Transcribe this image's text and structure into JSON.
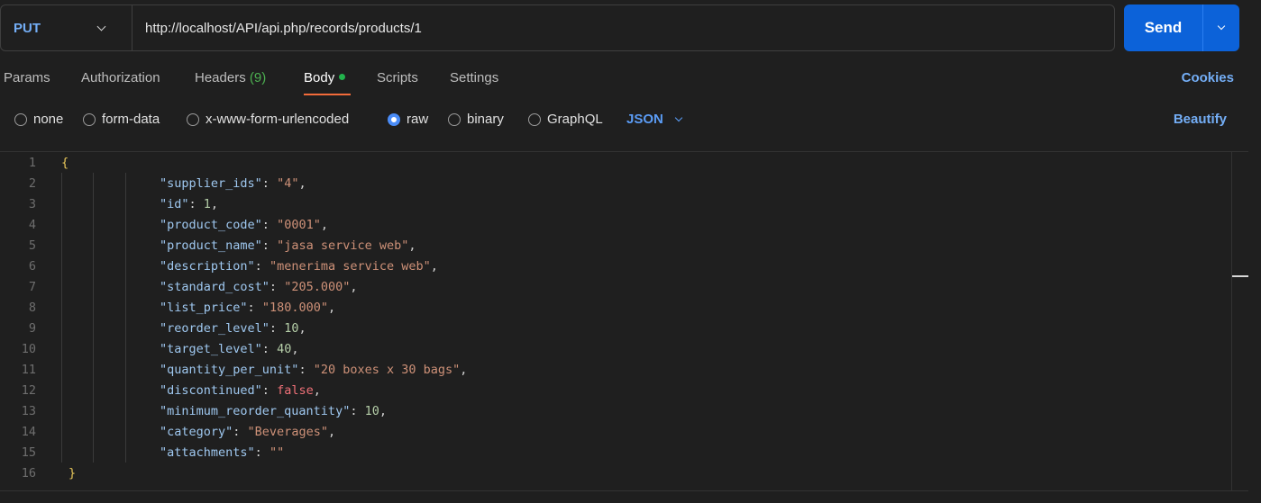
{
  "request": {
    "method": "PUT",
    "url": "http://localhost/API/api.php/records/products/1",
    "send_label": "Send"
  },
  "tabs": {
    "params": "Params",
    "authorization": "Authorization",
    "headers": "Headers",
    "headers_count": "(9)",
    "body": "Body",
    "scripts": "Scripts",
    "settings": "Settings",
    "cookies": "Cookies",
    "active": "Body"
  },
  "body_types": {
    "options": [
      "none",
      "form-data",
      "x-www-form-urlencoded",
      "raw",
      "binary",
      "GraphQL"
    ],
    "selected": "raw",
    "language": "JSON",
    "beautify": "Beautify"
  },
  "editor": {
    "lines": [
      {
        "n": "1",
        "open": "{"
      },
      {
        "n": "2",
        "key": "\"supplier_ids\"",
        "value": "\"4\"",
        "vtype": "str",
        "comma": ","
      },
      {
        "n": "3",
        "key": "\"id\"",
        "value": "1",
        "vtype": "num",
        "comma": ","
      },
      {
        "n": "4",
        "key": "\"product_code\"",
        "value": "\"0001\"",
        "vtype": "str",
        "comma": ","
      },
      {
        "n": "5",
        "key": "\"product_name\"",
        "value": "\"jasa service web\"",
        "vtype": "str",
        "comma": ","
      },
      {
        "n": "6",
        "key": "\"description\"",
        "value": "\"menerima service web\"",
        "vtype": "str",
        "comma": ","
      },
      {
        "n": "7",
        "key": "\"standard_cost\"",
        "value": "\"205.000\"",
        "vtype": "str",
        "comma": ","
      },
      {
        "n": "8",
        "key": "\"list_price\"",
        "value": "\"180.000\"",
        "vtype": "str",
        "comma": ","
      },
      {
        "n": "9",
        "key": "\"reorder_level\"",
        "value": "10",
        "vtype": "num",
        "comma": ","
      },
      {
        "n": "10",
        "key": "\"target_level\"",
        "value": "40",
        "vtype": "num",
        "comma": ","
      },
      {
        "n": "11",
        "key": "\"quantity_per_unit\"",
        "value": "\"20 boxes x 30 bags\"",
        "vtype": "str",
        "comma": ","
      },
      {
        "n": "12",
        "key": "\"discontinued\"",
        "value": "false",
        "vtype": "bool",
        "comma": ","
      },
      {
        "n": "13",
        "key": "\"minimum_reorder_quantity\"",
        "value": "10",
        "vtype": "num",
        "comma": ","
      },
      {
        "n": "14",
        "key": "\"category\"",
        "value": "\"Beverages\"",
        "vtype": "str",
        "comma": ","
      },
      {
        "n": "15",
        "key": "\"attachments\"",
        "value": "\"\"",
        "vtype": "str",
        "comma": ""
      },
      {
        "n": "16",
        "close": "}"
      }
    ]
  },
  "colors": {
    "send_button": "#0c62d9",
    "accent_link": "#74aef6",
    "active_tab_underline": "#f26b3a",
    "body_dot": "#22b24c",
    "json_key": "#9fc8f0",
    "json_string": "#ce9178",
    "json_number": "#b5cea8"
  }
}
